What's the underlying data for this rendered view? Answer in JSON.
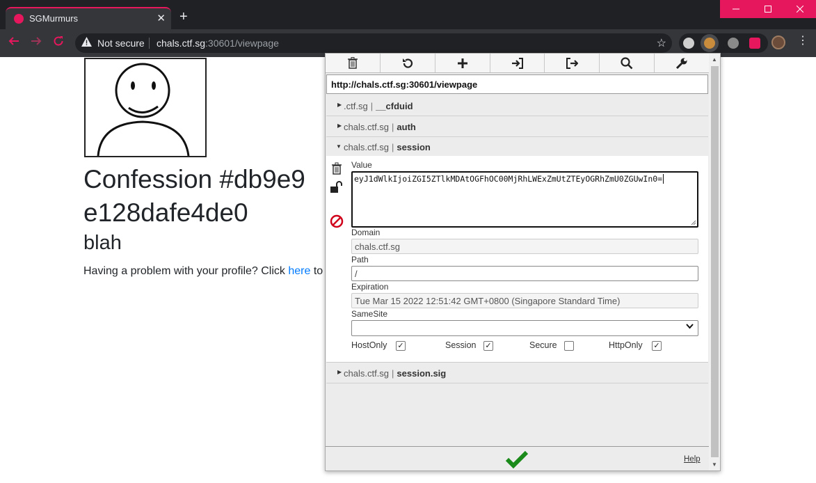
{
  "browser": {
    "tab_title": "SGMurmurs",
    "tab_close": "✕",
    "new_tab": "+",
    "security_label": "Not secure",
    "url_host": "chals.ctf.sg",
    "url_rest": ":30601/viewpage"
  },
  "page": {
    "title": "Confession #db9e9e128dafe4de0",
    "title_line1": "Confession #db9e9",
    "title_line2": "e128dafe4de0",
    "subtitle": "blah",
    "help_prefix": "Having a problem with your profile? Click ",
    "help_link": "here",
    "help_suffix": " to"
  },
  "cookie_editor": {
    "url": "http://chals.ctf.sg:30601/viewpage",
    "cookies": [
      {
        "domain": ".ctf.sg",
        "name": "__cfduid"
      },
      {
        "domain": "chals.ctf.sg",
        "name": "auth"
      },
      {
        "domain": "chals.ctf.sg",
        "name": "session"
      },
      {
        "domain": "chals.ctf.sg",
        "name": "session.sig"
      }
    ],
    "separator": "|",
    "expanded": {
      "value_label": "Value",
      "value": "eyJ1dWlkIjoiZGI5ZTlkMDAtOGFhOC00MjRhLWExZmUtZTEyOGRhZmU0ZGUwIn0=",
      "domain_label": "Domain",
      "domain": "chals.ctf.sg",
      "path_label": "Path",
      "path": "/",
      "expiration_label": "Expiration",
      "expiration": "Tue Mar 15 2022 12:51:42 GMT+0800 (Singapore Standard Time)",
      "samesite_label": "SameSite",
      "samesite": "",
      "flags": [
        {
          "label": "HostOnly",
          "checked": true
        },
        {
          "label": "Session",
          "checked": true
        },
        {
          "label": "Secure",
          "checked": false
        },
        {
          "label": "HttpOnly",
          "checked": true
        }
      ]
    },
    "help_label": "Help"
  },
  "colors": {
    "accent": "#e6175c",
    "link": "#007bff",
    "save": "#1a8a1a",
    "no_entry": "#d0021b"
  }
}
